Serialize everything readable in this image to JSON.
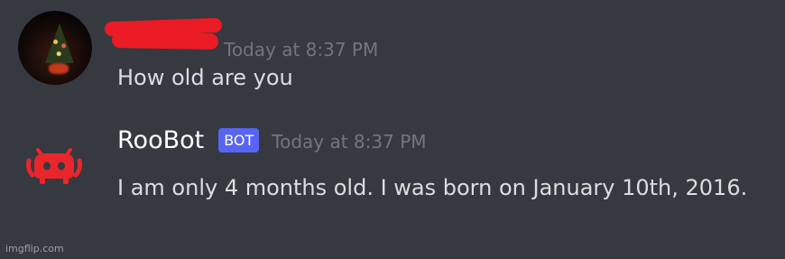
{
  "messages": [
    {
      "author_redacted": true,
      "timestamp": "Today at 8:37 PM",
      "content": "How old are you"
    },
    {
      "author": "RooBot",
      "badge": "BOT",
      "timestamp": "Today at 8:37 PM",
      "content": "I am only 4 months old. I was born on January 10th, 2016."
    }
  ],
  "colors": {
    "background": "#36393f",
    "bot_badge": "#5865f2",
    "redaction": "#ea1b24",
    "bot_avatar": "#e8262b"
  },
  "icons": {
    "user_avatar": "avatar-image",
    "bot_avatar": "discord-clyde-icon"
  },
  "watermark": "imgflip.com"
}
